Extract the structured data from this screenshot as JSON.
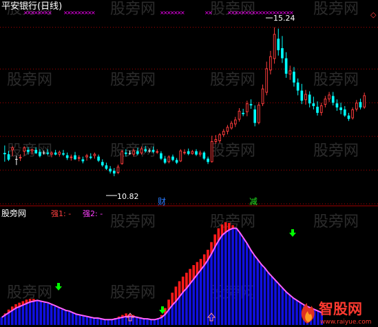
{
  "upper_panel": {
    "title": "平安银行(日线)",
    "high_label": "15.24",
    "low_label": "10.82",
    "mark_cai": "财",
    "mark_jian": "减",
    "diamond_glyph": "◇"
  },
  "lower_panel": {
    "title": "股旁网",
    "qiang1_label": "强1: -",
    "qiang2_label": "强2: -"
  },
  "watermarks": {
    "text": "股旁网",
    "brand_cn": "智股网",
    "brand_url": "www.raiyue.com"
  },
  "colors": {
    "background": "#000000",
    "up_candle": "#ff3c3c",
    "down_candle": "#00ffff",
    "doji": "#ffffff",
    "gridline": "#b40000",
    "separator": "#a00000",
    "title": "#ffffff",
    "qiang1": "#ff4040",
    "qiang2": "#ff40ff",
    "cross_mark": "#ff00ff",
    "mark_cai": "#2a7bff",
    "mark_jian": "#20e020",
    "blue_bar": "#1010e0",
    "red_bar": "#ff1a1a",
    "magenta_line": "#ff60ff",
    "green_arrow": "#00ff00",
    "pink_arrow": "#ff8fb0",
    "watermark": "#ffffff"
  },
  "chart_data": [
    {
      "type": "candlestick",
      "title": "平安银行(日线)",
      "price_range": [
        10.0,
        15.6
      ],
      "gridlines": [
        15.24,
        14.0,
        13.0,
        12.0,
        11.0,
        10.0
      ],
      "high": 15.24,
      "low": 10.82,
      "candles": [
        {
          "o": 11.51,
          "h": 11.73,
          "l": 11.25,
          "c": 11.47
        },
        {
          "o": 11.47,
          "h": 11.57,
          "l": 11.27,
          "c": 11.31
        },
        {
          "o": 11.59,
          "h": 11.71,
          "l": 11.41,
          "c": 11.67
        },
        {
          "o": 11.31,
          "h": 11.43,
          "l": 11.15,
          "c": 11.33
        },
        {
          "o": 11.37,
          "h": 11.47,
          "l": 11.27,
          "c": 11.39
        },
        {
          "o": 11.55,
          "h": 11.71,
          "l": 11.43,
          "c": 11.67
        },
        {
          "o": 11.6,
          "h": 11.68,
          "l": 11.46,
          "c": 11.54
        },
        {
          "o": 11.56,
          "h": 11.64,
          "l": 11.46,
          "c": 11.62
        },
        {
          "o": 11.6,
          "h": 11.68,
          "l": 11.48,
          "c": 11.5
        },
        {
          "o": 11.54,
          "h": 11.62,
          "l": 11.38,
          "c": 11.42
        },
        {
          "o": 11.5,
          "h": 11.58,
          "l": 11.46,
          "c": 11.52
        },
        {
          "o": 11.52,
          "h": 11.62,
          "l": 11.44,
          "c": 11.48
        },
        {
          "o": 11.46,
          "h": 11.56,
          "l": 11.38,
          "c": 11.52
        },
        {
          "o": 11.52,
          "h": 11.6,
          "l": 11.44,
          "c": 11.46
        },
        {
          "o": 11.46,
          "h": 11.58,
          "l": 11.4,
          "c": 11.54
        },
        {
          "o": 11.5,
          "h": 11.6,
          "l": 11.42,
          "c": 11.46
        },
        {
          "o": 11.44,
          "h": 11.52,
          "l": 11.3,
          "c": 11.36
        },
        {
          "o": 11.36,
          "h": 11.46,
          "l": 11.28,
          "c": 11.4
        },
        {
          "o": 11.44,
          "h": 11.54,
          "l": 11.3,
          "c": 11.32
        },
        {
          "o": 11.34,
          "h": 11.44,
          "l": 11.26,
          "c": 11.38
        },
        {
          "o": 11.32,
          "h": 11.4,
          "l": 11.2,
          "c": 11.26
        },
        {
          "o": 11.38,
          "h": 11.48,
          "l": 11.28,
          "c": 11.44
        },
        {
          "o": 11.4,
          "h": 11.5,
          "l": 11.32,
          "c": 11.36
        },
        {
          "o": 11.42,
          "h": 11.52,
          "l": 11.34,
          "c": 11.48
        },
        {
          "o": 11.4,
          "h": 11.46,
          "l": 11.24,
          "c": 11.28
        },
        {
          "o": 11.24,
          "h": 11.32,
          "l": 11.1,
          "c": 11.14
        },
        {
          "o": 11.14,
          "h": 11.22,
          "l": 11.0,
          "c": 11.04
        },
        {
          "o": 11.04,
          "h": 11.12,
          "l": 10.9,
          "c": 10.96
        },
        {
          "o": 10.98,
          "h": 11.06,
          "l": 10.82,
          "c": 10.9
        },
        {
          "o": 10.92,
          "h": 11.16,
          "l": 10.88,
          "c": 11.1
        },
        {
          "o": 11.18,
          "h": 11.6,
          "l": 11.16,
          "c": 11.56
        },
        {
          "o": 11.52,
          "h": 11.62,
          "l": 11.4,
          "c": 11.48
        },
        {
          "o": 11.48,
          "h": 11.58,
          "l": 11.46,
          "c": 11.5
        },
        {
          "o": 11.46,
          "h": 11.64,
          "l": 11.4,
          "c": 11.58
        },
        {
          "o": 11.56,
          "h": 11.66,
          "l": 11.44,
          "c": 11.48
        },
        {
          "o": 11.5,
          "h": 11.7,
          "l": 11.46,
          "c": 11.64
        },
        {
          "o": 11.62,
          "h": 11.72,
          "l": 11.52,
          "c": 11.56
        },
        {
          "o": 11.56,
          "h": 11.64,
          "l": 11.52,
          "c": 11.58
        },
        {
          "o": 11.6,
          "h": 11.7,
          "l": 11.5,
          "c": 11.54
        },
        {
          "o": 11.54,
          "h": 11.62,
          "l": 11.48,
          "c": 11.56
        },
        {
          "o": 11.5,
          "h": 11.56,
          "l": 11.3,
          "c": 11.34
        },
        {
          "o": 11.34,
          "h": 11.42,
          "l": 11.18,
          "c": 11.22
        },
        {
          "o": 11.24,
          "h": 11.44,
          "l": 11.2,
          "c": 11.4
        },
        {
          "o": 11.4,
          "h": 11.46,
          "l": 11.26,
          "c": 11.3
        },
        {
          "o": 11.3,
          "h": 11.36,
          "l": 11.18,
          "c": 11.22
        },
        {
          "o": 11.26,
          "h": 11.62,
          "l": 11.24,
          "c": 11.58
        },
        {
          "o": 11.5,
          "h": 11.62,
          "l": 11.46,
          "c": 11.54
        },
        {
          "o": 11.56,
          "h": 11.64,
          "l": 11.44,
          "c": 11.48
        },
        {
          "o": 11.48,
          "h": 11.6,
          "l": 11.46,
          "c": 11.56
        },
        {
          "o": 11.56,
          "h": 11.62,
          "l": 11.42,
          "c": 11.46
        },
        {
          "o": 11.46,
          "h": 11.58,
          "l": 11.4,
          "c": 11.52
        },
        {
          "o": 11.52,
          "h": 11.56,
          "l": 11.3,
          "c": 11.34
        },
        {
          "o": 11.34,
          "h": 11.4,
          "l": 11.18,
          "c": 11.24
        },
        {
          "o": 11.24,
          "h": 12.02,
          "l": 11.22,
          "c": 11.86
        },
        {
          "o": 11.84,
          "h": 12.04,
          "l": 11.78,
          "c": 11.92
        },
        {
          "o": 11.86,
          "h": 12.1,
          "l": 11.8,
          "c": 12.06
        },
        {
          "o": 12.04,
          "h": 12.22,
          "l": 11.98,
          "c": 12.16
        },
        {
          "o": 12.14,
          "h": 12.34,
          "l": 12.06,
          "c": 12.28
        },
        {
          "o": 12.24,
          "h": 12.46,
          "l": 12.2,
          "c": 12.4
        },
        {
          "o": 12.36,
          "h": 12.58,
          "l": 12.28,
          "c": 12.5
        },
        {
          "o": 12.5,
          "h": 12.84,
          "l": 12.44,
          "c": 12.76
        },
        {
          "o": 12.7,
          "h": 12.82,
          "l": 12.6,
          "c": 12.66
        },
        {
          "o": 12.72,
          "h": 13.06,
          "l": 12.6,
          "c": 12.98
        },
        {
          "o": 12.96,
          "h": 13.1,
          "l": 12.82,
          "c": 12.92
        },
        {
          "o": 12.8,
          "h": 12.92,
          "l": 12.3,
          "c": 12.4
        },
        {
          "o": 12.4,
          "h": 13.02,
          "l": 12.36,
          "c": 12.94
        },
        {
          "o": 12.96,
          "h": 13.54,
          "l": 12.9,
          "c": 13.42
        },
        {
          "o": 13.3,
          "h": 14.22,
          "l": 13.22,
          "c": 14.02
        },
        {
          "o": 13.96,
          "h": 14.54,
          "l": 13.84,
          "c": 14.38
        },
        {
          "o": 14.3,
          "h": 15.24,
          "l": 14.16,
          "c": 15.04
        },
        {
          "o": 14.9,
          "h": 15.2,
          "l": 14.4,
          "c": 14.56
        },
        {
          "o": 14.62,
          "h": 14.98,
          "l": 14.18,
          "c": 14.32
        },
        {
          "o": 14.32,
          "h": 14.5,
          "l": 13.74,
          "c": 13.86
        },
        {
          "o": 13.84,
          "h": 14.1,
          "l": 13.68,
          "c": 13.96
        },
        {
          "o": 13.92,
          "h": 14.06,
          "l": 13.48,
          "c": 13.6
        },
        {
          "o": 13.6,
          "h": 13.72,
          "l": 13.22,
          "c": 13.36
        },
        {
          "o": 13.36,
          "h": 13.56,
          "l": 12.96,
          "c": 13.06
        },
        {
          "o": 13.08,
          "h": 13.38,
          "l": 12.94,
          "c": 13.26
        },
        {
          "o": 13.24,
          "h": 13.34,
          "l": 12.86,
          "c": 12.98
        },
        {
          "o": 12.98,
          "h": 13.18,
          "l": 12.8,
          "c": 12.9
        },
        {
          "o": 12.88,
          "h": 13.04,
          "l": 12.62,
          "c": 12.7
        },
        {
          "o": 12.7,
          "h": 13.0,
          "l": 12.62,
          "c": 12.92
        },
        {
          "o": 12.94,
          "h": 13.2,
          "l": 12.86,
          "c": 13.12
        },
        {
          "o": 13.1,
          "h": 13.32,
          "l": 13.02,
          "c": 13.24
        },
        {
          "o": 13.2,
          "h": 13.32,
          "l": 12.92,
          "c": 13.0
        },
        {
          "o": 12.98,
          "h": 13.1,
          "l": 12.76,
          "c": 12.86
        },
        {
          "o": 12.86,
          "h": 13.0,
          "l": 12.66,
          "c": 12.78
        },
        {
          "o": 12.8,
          "h": 12.9,
          "l": 12.58,
          "c": 12.62
        },
        {
          "o": 12.62,
          "h": 12.7,
          "l": 12.46,
          "c": 12.52
        },
        {
          "o": 12.54,
          "h": 12.86,
          "l": 12.5,
          "c": 12.8
        },
        {
          "o": 12.8,
          "h": 13.08,
          "l": 12.74,
          "c": 13.0
        },
        {
          "o": 13.02,
          "h": 13.12,
          "l": 12.8,
          "c": 12.86
        },
        {
          "o": 12.86,
          "h": 13.3,
          "l": 12.82,
          "c": 13.22
        }
      ]
    },
    {
      "type": "bar",
      "title": "股旁网",
      "series": [
        {
          "name": "强1",
          "values": [
            10,
            15,
            20,
            24,
            27,
            29,
            31,
            33,
            34,
            34,
            32,
            31,
            29,
            28,
            26,
            24,
            22,
            20,
            19,
            17,
            16,
            14,
            13,
            12,
            11,
            10,
            9,
            9,
            8,
            7,
            7,
            7,
            9,
            11,
            13,
            15,
            14,
            13,
            11,
            10,
            9,
            8,
            7,
            7,
            9,
            13,
            22,
            33,
            42,
            50,
            57,
            63,
            68,
            73,
            78,
            82,
            86,
            92,
            98,
            108,
            118,
            126,
            131,
            134,
            133,
            130,
            126,
            120,
            113,
            106,
            98,
            91,
            85,
            79,
            74,
            68,
            63,
            58,
            53,
            48,
            43,
            39,
            35,
            32,
            29,
            26,
            24,
            22,
            20,
            18,
            16
          ]
        },
        {
          "name": "强2",
          "values": [
            10,
            13,
            16,
            19,
            22,
            24,
            26,
            28,
            30,
            31,
            32,
            31,
            30,
            29,
            27,
            25,
            23,
            21,
            19,
            18,
            16,
            14,
            13,
            12,
            11,
            10,
            9,
            9,
            8,
            7,
            7,
            7,
            8,
            9,
            10,
            11,
            11,
            11,
            10,
            9,
            8,
            8,
            7,
            7,
            8,
            10,
            14,
            20,
            26,
            31,
            37,
            43,
            48,
            54,
            60,
            66,
            72,
            78,
            85,
            93,
            102,
            110,
            117,
            121,
            124,
            126,
            126,
            120,
            113,
            106,
            98,
            91,
            85,
            79,
            74,
            68,
            63,
            58,
            53,
            48,
            43,
            39,
            35,
            32,
            29,
            26,
            24,
            22,
            20,
            18,
            16
          ]
        }
      ],
      "value_range": [
        0,
        140
      ]
    }
  ]
}
